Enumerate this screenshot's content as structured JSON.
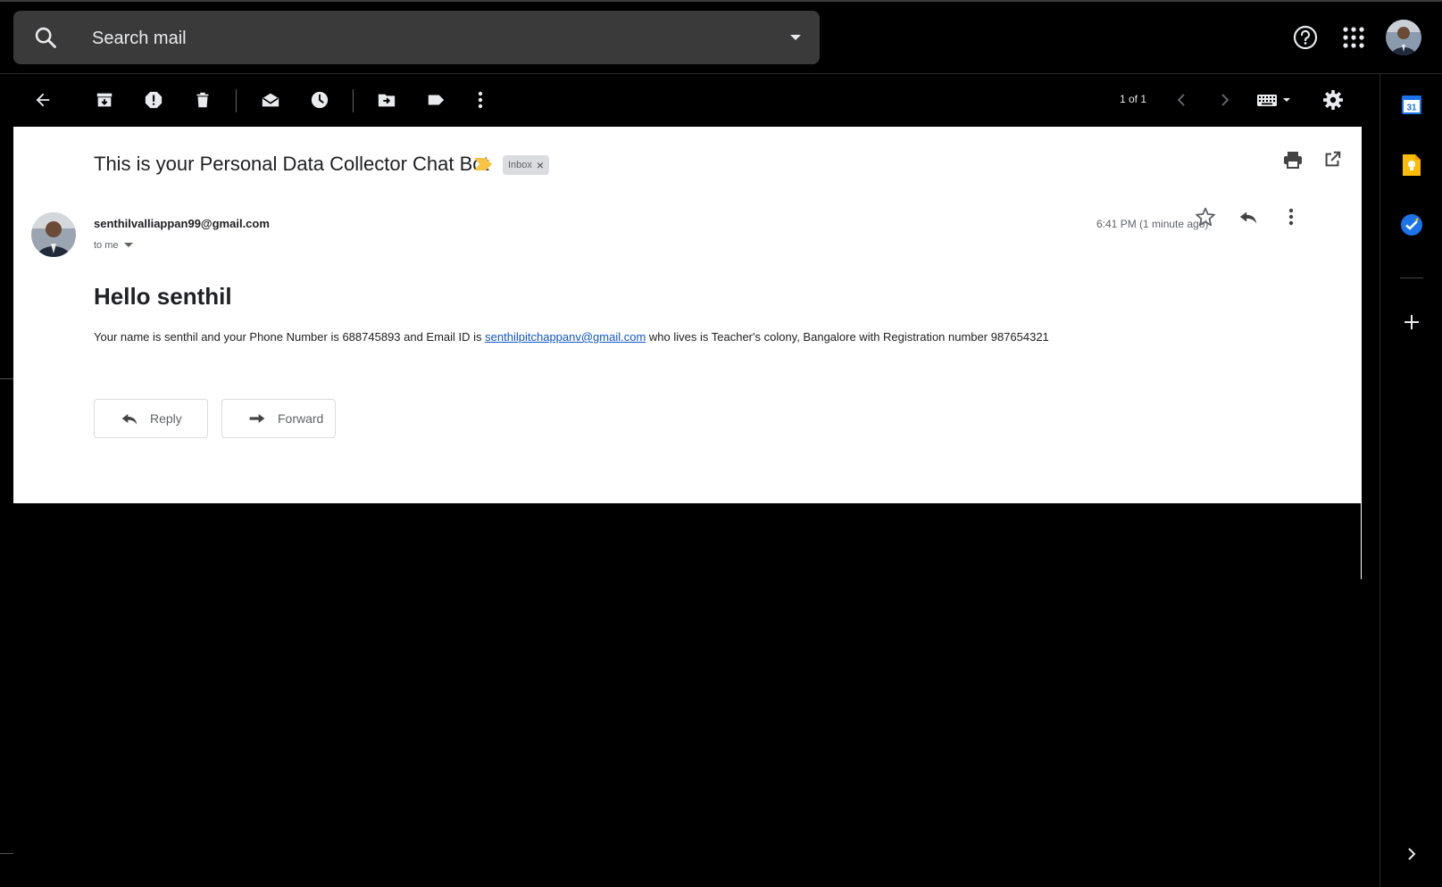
{
  "header": {
    "search_placeholder": "Search mail",
    "icons": [
      "search-icon",
      "dropdown-icon",
      "help-icon",
      "apps-icon",
      "account-avatar"
    ]
  },
  "toolbar": {
    "icons": [
      "back-icon",
      "archive-icon",
      "report-spam-icon",
      "delete-icon",
      "mark-unread-icon",
      "snooze-icon",
      "move-to-icon",
      "label-icon",
      "more-icon",
      "newer-icon",
      "older-icon",
      "keyboard-icon",
      "settings-icon"
    ],
    "pager": "1 of 1"
  },
  "message": {
    "subject": "This is your Personal Data Collector Chat Bot",
    "label": "Inbox",
    "sender": "senthilvalliappan99@gmail.com",
    "recipient": "to me",
    "time": "6:41 PM (1 minute ago)",
    "greeting": "Hello senthil",
    "body_before_link": "Your name is senthil and your Phone Number is 688745893 and Email ID is ",
    "body_link": "senthilpitchappanv@gmail.com",
    "body_after_link": " who lives is Teacher's colony, Bangalore with Registration number 987654321",
    "reply_label": "Reply",
    "forward_label": "Forward"
  },
  "side_panel": {
    "calendar_day": "31",
    "icons": [
      "calendar-icon",
      "keep-icon",
      "tasks-icon",
      "add-icon",
      "expand-icon"
    ]
  },
  "colors": {
    "background": "#000000",
    "search_bg": "#3a3a3a",
    "card_bg": "#ffffff",
    "link": "#1155cc",
    "important_marker": "#f6c344",
    "calendar_blue": "#1a73e8",
    "keep_yellow": "#fbbc04"
  }
}
